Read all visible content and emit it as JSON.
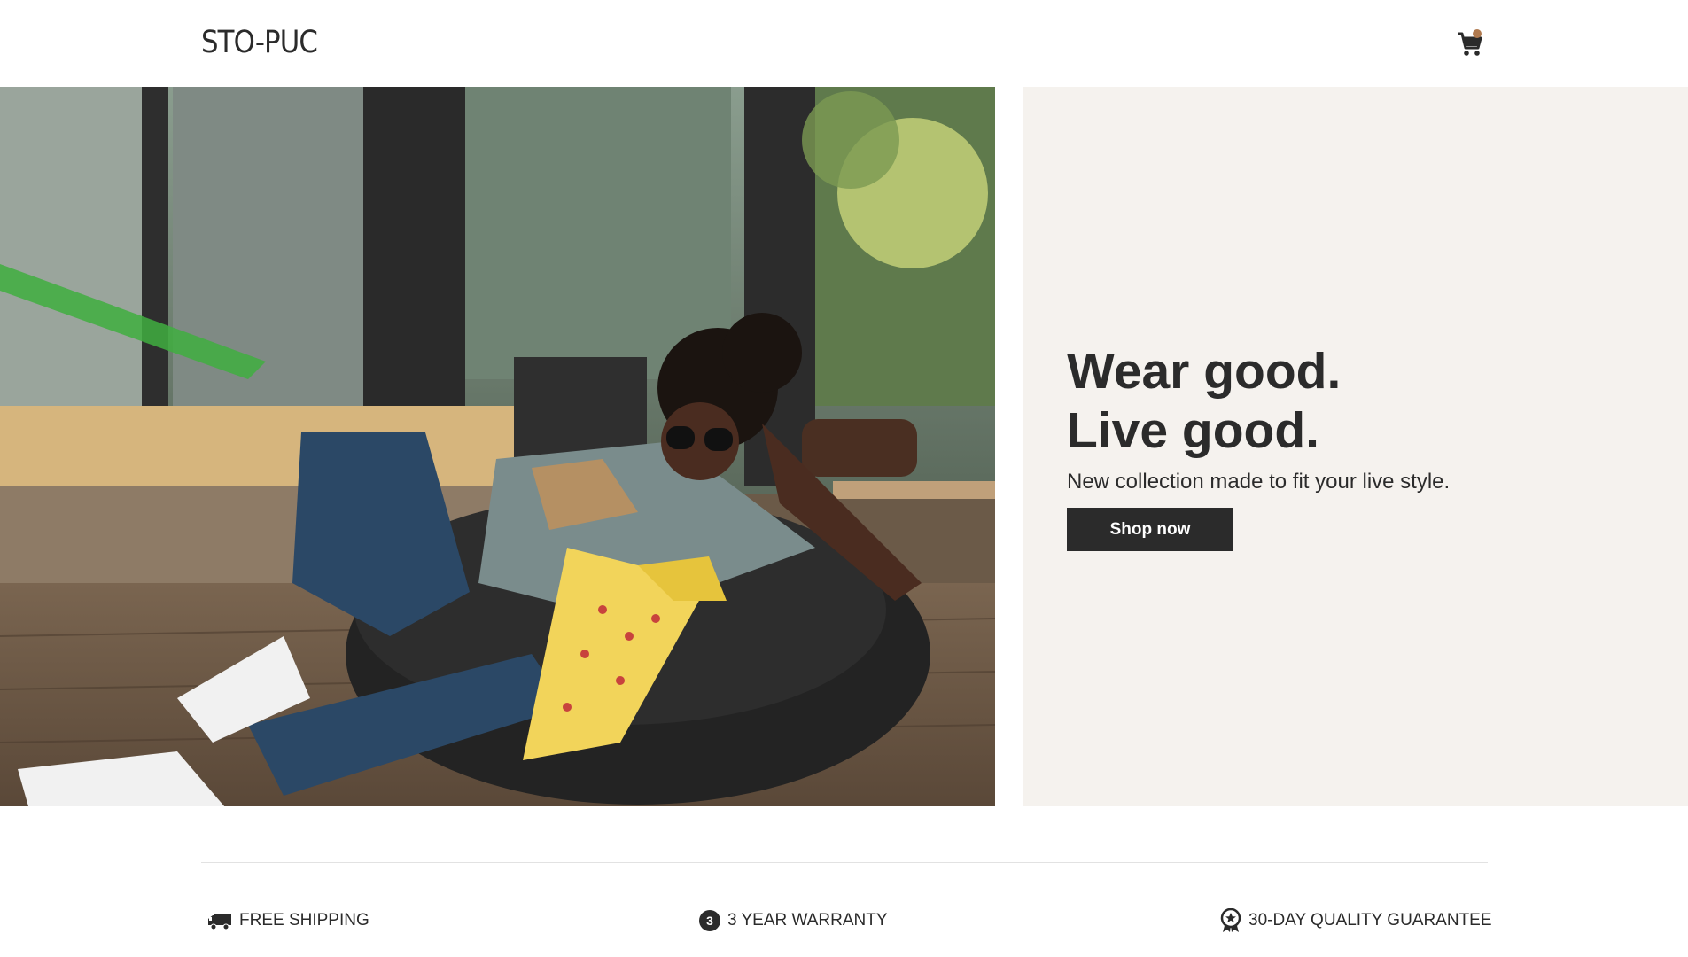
{
  "header": {
    "logo": "STO-PUC",
    "cart_icon": "shopping-cart-icon"
  },
  "hero": {
    "image": "woman-on-beanbag-photo",
    "headline_line1": "Wear good.",
    "headline_line2": "Live good.",
    "subline": "New collection made to fit your live style.",
    "cta_label": "Shop now"
  },
  "features": [
    {
      "icon": "truck-icon",
      "label": "FREE SHIPPING"
    },
    {
      "icon": "number-3-badge-icon",
      "label": "3 YEAR WARRANTY"
    },
    {
      "icon": "award-ribbon-icon",
      "label": "30-DAY QUALITY GUARANTEE"
    }
  ],
  "colors": {
    "text": "#2b2b2b",
    "panel_bg": "#f5f2ee",
    "button_bg": "#2b2b2b",
    "cart_badge": "#b07a4f",
    "divider": "#e2e2e2"
  }
}
